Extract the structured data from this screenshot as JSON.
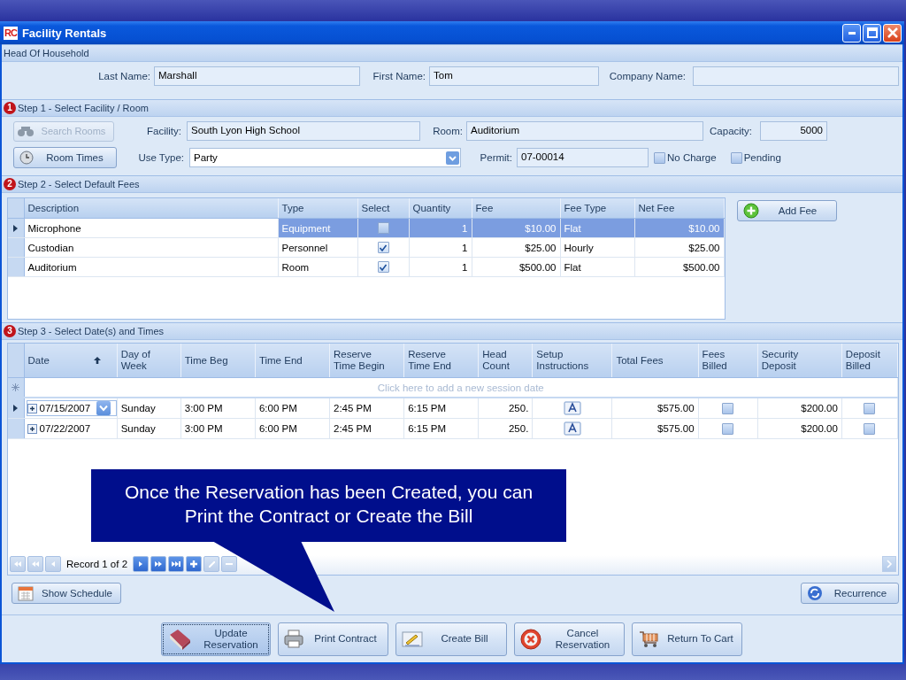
{
  "window": {
    "title": "Facility Rentals",
    "logo": "RC"
  },
  "head_of_household": {
    "title": "Head Of Household",
    "fields": [
      {
        "label": "Last Name:",
        "value": "Marshall"
      },
      {
        "label": "First Name:",
        "value": "Tom"
      },
      {
        "label": "Company Name:"
      }
    ]
  },
  "step1": {
    "badge": "1",
    "title": "Step 1 - Select Facility / Room",
    "search_button": {
      "label": "Search Rooms",
      "disabled": true
    },
    "room_times_button": {
      "label": "Room Times",
      "disabled": false
    },
    "facility": {
      "label": "Facility:",
      "value": "South Lyon High School"
    },
    "room": {
      "label": "Room:",
      "value": "Auditorium"
    },
    "capacity": {
      "label": "Capacity:",
      "value": "5000"
    },
    "use_type": {
      "label": "Use Type:",
      "value": "Party"
    },
    "permit": {
      "label": "Permit:",
      "value": "07-00014"
    },
    "checkboxes": [
      {
        "label": "No Charge",
        "checked": false
      },
      {
        "label": "Pending",
        "checked": false
      }
    ]
  },
  "step2": {
    "badge": "2",
    "title": "Step 2 - Select Default Fees",
    "columns": [
      "Description",
      "Type",
      "Select",
      "Quantity",
      "Fee",
      "Fee Type",
      "Net Fee"
    ],
    "rows": [
      {
        "selected": true,
        "description": "Microphone",
        "type": "Equipment",
        "select": false,
        "quantity": "1",
        "fee": "$10.00",
        "fee_type": "Flat",
        "net_fee": "$10.00"
      },
      {
        "selected": false,
        "description": "Custodian",
        "type": "Personnel",
        "select": true,
        "quantity": "1",
        "fee": "$25.00",
        "fee_type": "Hourly",
        "net_fee": "$25.00"
      },
      {
        "selected": false,
        "description": "Auditorium",
        "type": "Room",
        "select": true,
        "quantity": "1",
        "fee": "$500.00",
        "fee_type": "Flat",
        "net_fee": "$500.00"
      }
    ],
    "add_button": {
      "label": "Add Fee"
    }
  },
  "step3": {
    "badge": "3",
    "title": "Step 3 - Select Date(s) and Times",
    "columns": [
      {
        "label": "Date",
        "sorted": true
      },
      {
        "label": "Day of\nWeek",
        "sorted": false
      },
      {
        "label": "Time Beg",
        "sorted": false
      },
      {
        "label": "Time End",
        "sorted": false
      },
      {
        "label": "Reserve\nTime Begin",
        "sorted": false
      },
      {
        "label": "Reserve\nTime End",
        "sorted": false
      },
      {
        "label": "Head\nCount",
        "sorted": false
      },
      {
        "label": "Setup\nInstructions",
        "sorted": false
      },
      {
        "label": "Total Fees",
        "sorted": false
      },
      {
        "label": "Fees\nBilled",
        "sorted": false
      },
      {
        "label": "Security\nDeposit",
        "sorted": false
      },
      {
        "label": "Deposit\nBilled",
        "sorted": false
      }
    ],
    "new_row_hint": "Click here to add a new session date",
    "rows": [
      {
        "selected": true,
        "expanded": false,
        "editing": true,
        "date": "07/15/2007",
        "day": "Sunday",
        "time_beg": "3:00 PM",
        "time_end": "6:00 PM",
        "reserve_begin": "2:45 PM",
        "reserve_end": "6:15 PM",
        "head_count": "250.",
        "total_fees": "$575.00",
        "fees_billed": false,
        "security_deposit": "$200.00",
        "deposit_billed": false
      },
      {
        "selected": false,
        "expanded": false,
        "editing": false,
        "date": "07/22/2007",
        "day": "Sunday",
        "time_beg": "3:00 PM",
        "time_end": "6:00 PM",
        "reserve_begin": "2:45 PM",
        "reserve_end": "6:15 PM",
        "head_count": "250.",
        "total_fees": "$575.00",
        "fees_billed": false,
        "security_deposit": "$200.00",
        "deposit_billed": false
      }
    ],
    "navigator": {
      "record": "Record 1 of 2",
      "buttons": [
        {
          "kind": "first",
          "disabled": true
        },
        {
          "kind": "prev_page",
          "disabled": true
        },
        {
          "kind": "prev",
          "disabled": true
        },
        {
          "kind": "next",
          "disabled": false
        },
        {
          "kind": "next_page",
          "disabled": false
        },
        {
          "kind": "last",
          "disabled": false
        },
        {
          "kind": "add",
          "disabled": false
        },
        {
          "kind": "edit",
          "disabled": true
        },
        {
          "kind": "delete",
          "disabled": true
        }
      ]
    },
    "show_schedule_button": {
      "label": "Show Schedule"
    },
    "recurrence_button": {
      "label": "Recurrence"
    }
  },
  "actions": [
    {
      "kind": "update",
      "label": "Update\nReservation",
      "focused": true
    },
    {
      "kind": "print",
      "label": "Print Contract",
      "focused": false
    },
    {
      "kind": "bill",
      "label": "Create Bill",
      "focused": false
    },
    {
      "kind": "cancel",
      "label": "Cancel\nReservation",
      "focused": false
    },
    {
      "kind": "cart",
      "label": "Return To Cart",
      "focused": false
    }
  ],
  "callout": {
    "text": "Once the Reservation has been Created, you can Print the Contract or Create the Bill"
  }
}
